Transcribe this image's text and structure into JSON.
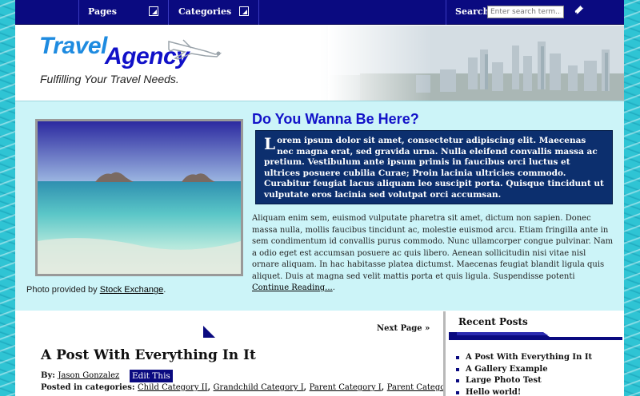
{
  "nav": {
    "pages_label": "Pages",
    "categories_label": "Categories",
    "search_label": "Search:",
    "search_placeholder": "Enter search term..."
  },
  "header": {
    "logo_word1": "Travel",
    "logo_word2": "Agency",
    "tagline": "Fulfilling Your Travel Needs."
  },
  "feature": {
    "title": "Do You Wanna Be Here?",
    "callout_dropcap": "L",
    "callout_text": "orem ipsum dolor sit amet, consectetur adipiscing elit. Maecenas nec magna erat, sed gravida urna. Nulla eleifend convallis massa ac pretium. Vestibulum ante ipsum primis in faucibus orci luctus et ultrices posuere cubilia Curae; Proin lacinia ultricies commodo. Curabitur feugiat lacus aliquam leo suscipit porta. Quisque tincidunt ut vulputate eros lacinia sed volutpat orci accumsan.",
    "body_text": "Aliquam enim sem, euismod vulputate pharetra sit amet, dictum non sapien. Donec massa nulla, mollis faucibus tincidunt ac, molestie euismod arcu. Etiam fringilla ante in sem condimentum id convallis purus commodo. Nunc ullamcorper congue pulvinar. Nam a odio eget est accumsan posuere ac quis libero. Aenean sollicitudin nisi vitae nisl ornare aliquam. In hac habitasse platea dictumst. Maecenas feugiat blandit ligula quis aliquet. Duis at magna sed velit mattis porta et quis ligula. Suspendisse potenti",
    "continue_link": "Continue Reading...",
    "continue_suffix": ".",
    "photo_credit_prefix": "Photo provided by",
    "photo_credit_link": "Stock Exchange",
    "photo_credit_suffix": "."
  },
  "main": {
    "next_page": "Next Page »",
    "post_title": "A Post With Everything In It",
    "by_label": "By:",
    "author": "Jason Gonzalez",
    "edit_label": "Edit This",
    "posted_in_label": "Posted in categories:",
    "categories": [
      "Child Category II",
      "Grandchild Category I",
      "Parent Category I",
      "Parent Category II"
    ]
  },
  "sidebar": {
    "heading": "Recent Posts",
    "recent_posts": [
      "A Post With Everything In It",
      "A Gallery Example",
      "Large Photo Test",
      "Hello world!"
    ]
  },
  "colors": {
    "nav_bg": "#0a0a80",
    "accent_blue": "#1212c8",
    "feature_bg": "#ccf4f8",
    "callout_bg": "#0c2f6e",
    "water_bg": "#2fc4d4"
  },
  "icons": {
    "pages_dropdown": "dropdown-arrow-icon",
    "categories_dropdown": "dropdown-arrow-icon",
    "search_button": "pencil-icon",
    "prev_page": "triangle-arrow-icon"
  }
}
